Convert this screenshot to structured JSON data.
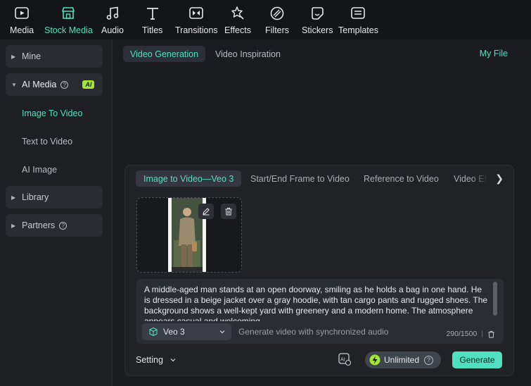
{
  "toolbar": {
    "items": [
      {
        "label": "Media",
        "icon": "media-icon"
      },
      {
        "label": "Stock Media",
        "icon": "stock-media-icon",
        "active": true
      },
      {
        "label": "Audio",
        "icon": "audio-icon"
      },
      {
        "label": "Titles",
        "icon": "titles-icon"
      },
      {
        "label": "Transitions",
        "icon": "transitions-icon"
      },
      {
        "label": "Effects",
        "icon": "effects-icon"
      },
      {
        "label": "Filters",
        "icon": "filters-icon"
      },
      {
        "label": "Stickers",
        "icon": "stickers-icon"
      },
      {
        "label": "Templates",
        "icon": "templates-icon"
      }
    ]
  },
  "sidebar": {
    "mine": "Mine",
    "ai_media": "AI Media",
    "ai_badge": "AI",
    "sub_items": [
      "Image To Video",
      "Text to Video",
      "AI Image"
    ],
    "library": "Library",
    "partners": "Partners"
  },
  "main": {
    "tabs": [
      "Video Generation",
      "Video Inspiration"
    ],
    "my_file": "My File",
    "mode_tabs": [
      "Image to Video—Veo 3",
      "Start/End Frame to Video",
      "Reference to Video",
      "Video Ef"
    ],
    "prompt": "A middle-aged man stands at an open doorway, smiling as he holds a bag in one hand. He is dressed in a beige jacket over a gray hoodie, with tan cargo pants and rugged shoes. The background shows a well-kept yard with greenery and a modern home. The atmosphere appears casual and welcoming.",
    "model": "Veo 3",
    "hint": "Generate video with synchronized audio",
    "counter": "290/1500",
    "counter_sep": "|",
    "setting": "Setting",
    "unlimited": "Unlimited",
    "generate": "Generate"
  },
  "colors": {
    "accent": "#4fe0c0",
    "ai_badge": "#a3e635"
  }
}
